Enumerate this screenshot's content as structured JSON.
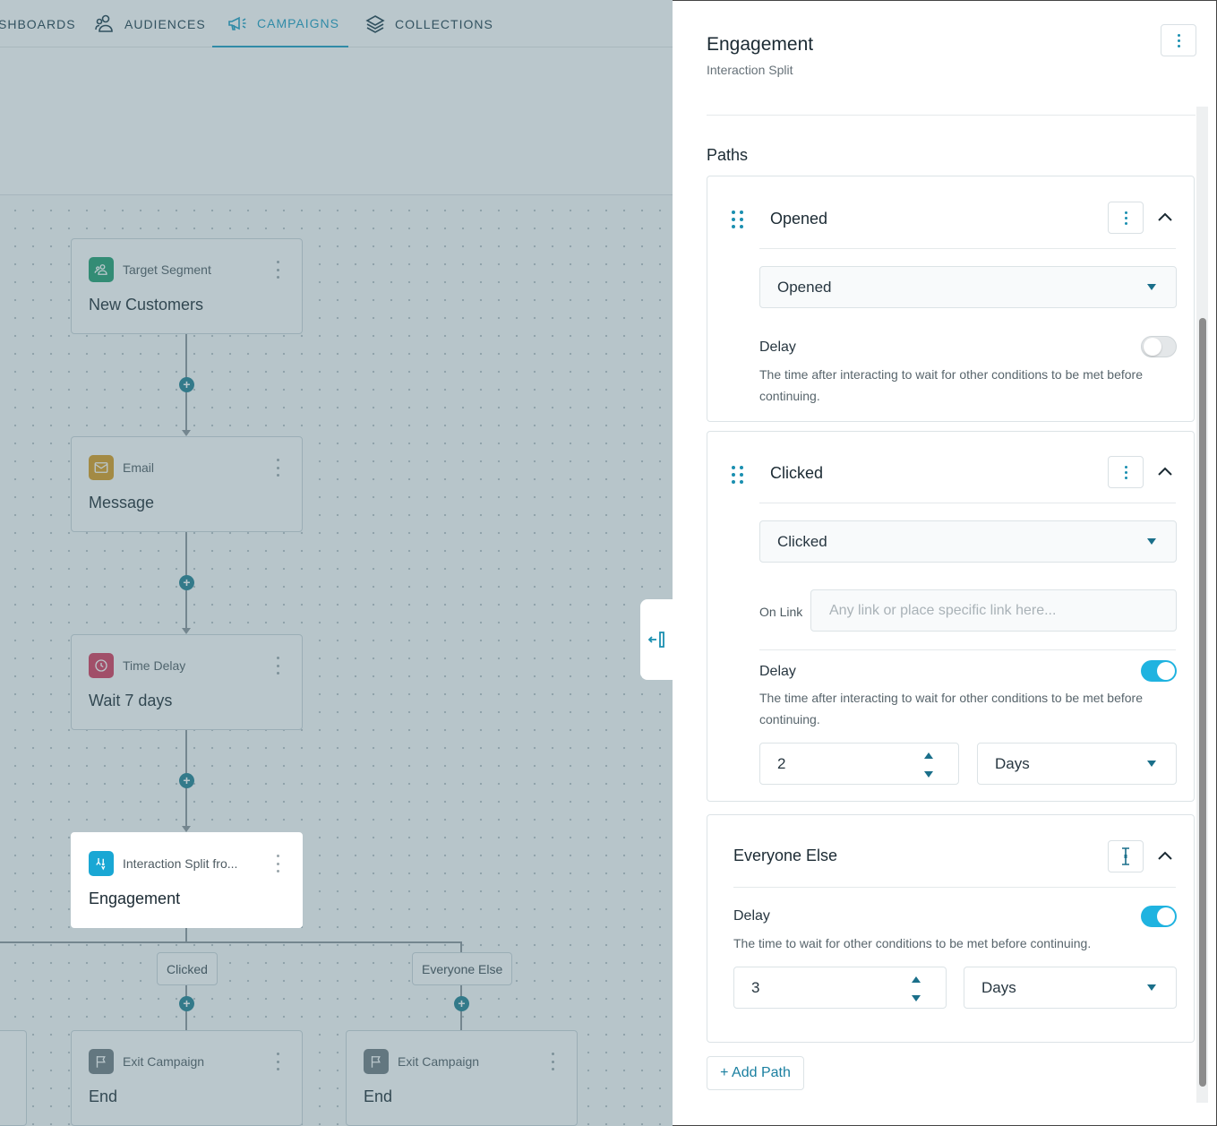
{
  "nav": {
    "items": [
      {
        "label": "SHBOARDS",
        "icon": "dashboard-icon"
      },
      {
        "label": "AUDIENCES",
        "icon": "audiences-icon"
      },
      {
        "label": "CAMPAIGNS",
        "icon": "megaphone-icon",
        "active": true
      },
      {
        "label": "COLLECTIONS",
        "icon": "layers-icon"
      }
    ]
  },
  "flow": {
    "nodes": [
      {
        "type": "Target Segment",
        "name": "New Customers",
        "icon": "audience-icon",
        "color": "#1e9d6e"
      },
      {
        "type": "Email",
        "name": "Message",
        "icon": "envelope-icon",
        "color": "#d99a1d"
      },
      {
        "type": "Time Delay",
        "name": "Wait 7 days",
        "icon": "clock-icon",
        "color": "#d6385a"
      },
      {
        "type": "Interaction Split fro...",
        "name": "Engagement",
        "icon": "split-icon",
        "color": "#19a7d4"
      },
      {
        "type": "Exit Campaign",
        "name": "End",
        "icon": "flag-icon",
        "color": "#6f7a80"
      },
      {
        "type": "Exit Campaign",
        "name": "End",
        "icon": "flag-icon",
        "color": "#6f7a80"
      }
    ],
    "branches": [
      "Clicked",
      "Everyone Else"
    ]
  },
  "panel": {
    "title": "Engagement",
    "subtitle": "Interaction Split",
    "paths_heading": "Paths",
    "paths": [
      {
        "title": "Opened",
        "condition": "Opened",
        "delay_label": "Delay",
        "delay_desc": "The time after interacting to wait for other conditions to be met before continuing.",
        "delay_on": false
      },
      {
        "title": "Clicked",
        "condition": "Clicked",
        "link_label": "On Link",
        "link_placeholder": "Any link or place specific link here...",
        "delay_label": "Delay",
        "delay_desc": "The time after interacting to wait for other conditions to be met before continuing.",
        "delay_on": true,
        "delay_value": "2",
        "delay_unit": "Days"
      },
      {
        "title": "Everyone Else",
        "delay_label": "Delay",
        "delay_desc": "The time to wait for other conditions to be met before continuing.",
        "delay_on": true,
        "delay_value": "3",
        "delay_unit": "Days"
      }
    ],
    "add_path_label": "+ Add Path"
  },
  "colors": {
    "accent": "#1a9bc2",
    "toggle_on": "#1fb3e0",
    "connector_dot": "#1f7f91"
  }
}
